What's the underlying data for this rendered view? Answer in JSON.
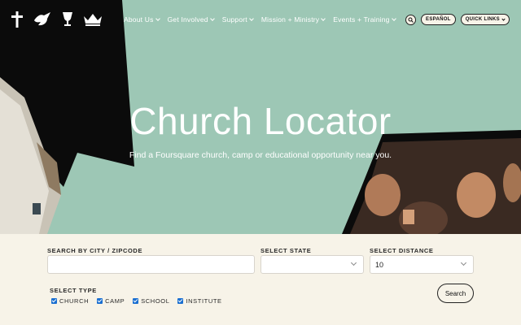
{
  "nav": {
    "icons": [
      "cross-icon",
      "dove-icon",
      "cup-icon",
      "crown-icon"
    ],
    "menu": [
      {
        "label": "About Us"
      },
      {
        "label": "Get Involved"
      },
      {
        "label": "Support"
      },
      {
        "label": "Mission + Ministry"
      },
      {
        "label": "Events + Training"
      }
    ],
    "espanol_label": "ESPAÑOL",
    "quick_links_label": "QUICK LINKS"
  },
  "hero": {
    "title": "Church Locator",
    "subtitle": "Find a Foursquare church, camp or educational opportunity near you.",
    "colors": {
      "background": "#9dc7b5",
      "shape": "#0b0b0b"
    }
  },
  "form": {
    "city_label": "SEARCH BY CITY / ZIPCODE",
    "city_value": "",
    "state_label": "SELECT STATE",
    "state_value": "",
    "distance_label": "SELECT DISTANCE",
    "distance_value": "10",
    "type_label": "SELECT TYPE",
    "types": [
      {
        "label": "CHURCH",
        "checked": true
      },
      {
        "label": "CAMP",
        "checked": true
      },
      {
        "label": "SCHOOL",
        "checked": true
      },
      {
        "label": "INSTITUTE",
        "checked": true
      }
    ],
    "search_label": "Search"
  }
}
